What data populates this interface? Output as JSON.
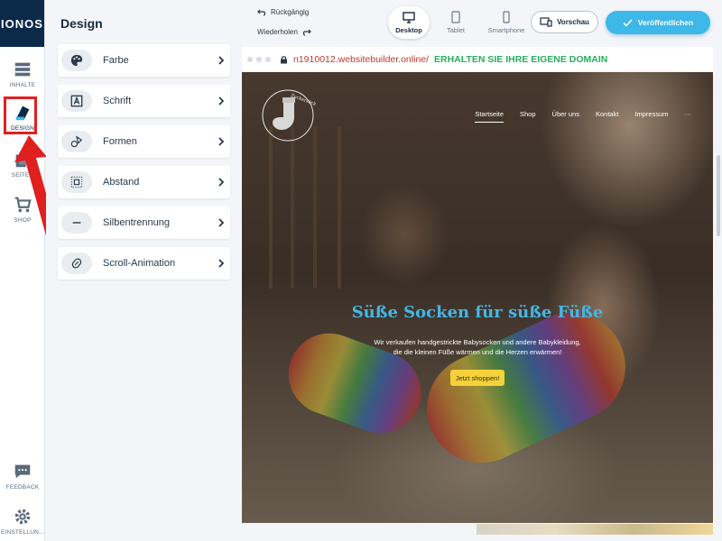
{
  "app": {
    "logo": "IONOS"
  },
  "rail": {
    "items": [
      {
        "id": "inhalte",
        "label": "INHALTE",
        "icon": "content-layout-icon"
      },
      {
        "id": "design",
        "label": "DESIGN",
        "icon": "design-palette-icon",
        "active": true
      },
      {
        "id": "seiten",
        "label": "SEITEN",
        "icon": "pages-icon"
      },
      {
        "id": "shop",
        "label": "SHOP",
        "icon": "cart-icon"
      }
    ],
    "feedback": {
      "label": "FEEDBACK",
      "icon": "chat-icon"
    },
    "settings": {
      "label": "EINSTELLUN...",
      "icon": "gear-icon"
    }
  },
  "panel": {
    "title": "Design",
    "items": [
      {
        "label": "Farbe",
        "icon": "palette-icon"
      },
      {
        "label": "Schrift",
        "icon": "font-icon"
      },
      {
        "label": "Formen",
        "icon": "shapes-icon"
      },
      {
        "label": "Abstand",
        "icon": "spacing-icon"
      },
      {
        "label": "Silbentrennung",
        "icon": "hyphen-icon"
      },
      {
        "label": "Scroll-Animation",
        "icon": "animation-icon"
      }
    ]
  },
  "toolbar": {
    "undo": "Rückgängig",
    "redo": "Wiederholen",
    "devices": [
      {
        "label": "Desktop",
        "active": true
      },
      {
        "label": "Tablet"
      },
      {
        "label": "Smartphone"
      }
    ],
    "preview": "Vorschau",
    "publish": "Veröffentlichen"
  },
  "browser": {
    "url": "n1910012.websitebuilder.online/",
    "domain_cta": "ERHALTEN SIE IHRE EIGENE DOMAIN"
  },
  "site": {
    "logo_text": "Zuckersöckchen",
    "nav": [
      "Startseite",
      "Shop",
      "Über uns",
      "Kontakt",
      "Impressum",
      "···"
    ],
    "hero_title": "Süße Socken für süße Füße",
    "hero_sub_1": "Wir verkaufen handgestrickte Babysocken und andere Babykleidung,",
    "hero_sub_2": "die die kleinen Füße wärmen und die Herzen erwärmen!",
    "hero_cta": "Jetzt shoppen!"
  },
  "colors": {
    "accent": "#3db8e8",
    "brand_dark": "#0b2a4a",
    "highlight": "#e0201f",
    "url": "#c0392b",
    "domain_cta": "#27ae60",
    "hero_title": "#43b7e6",
    "cta": "#f5d23a"
  }
}
